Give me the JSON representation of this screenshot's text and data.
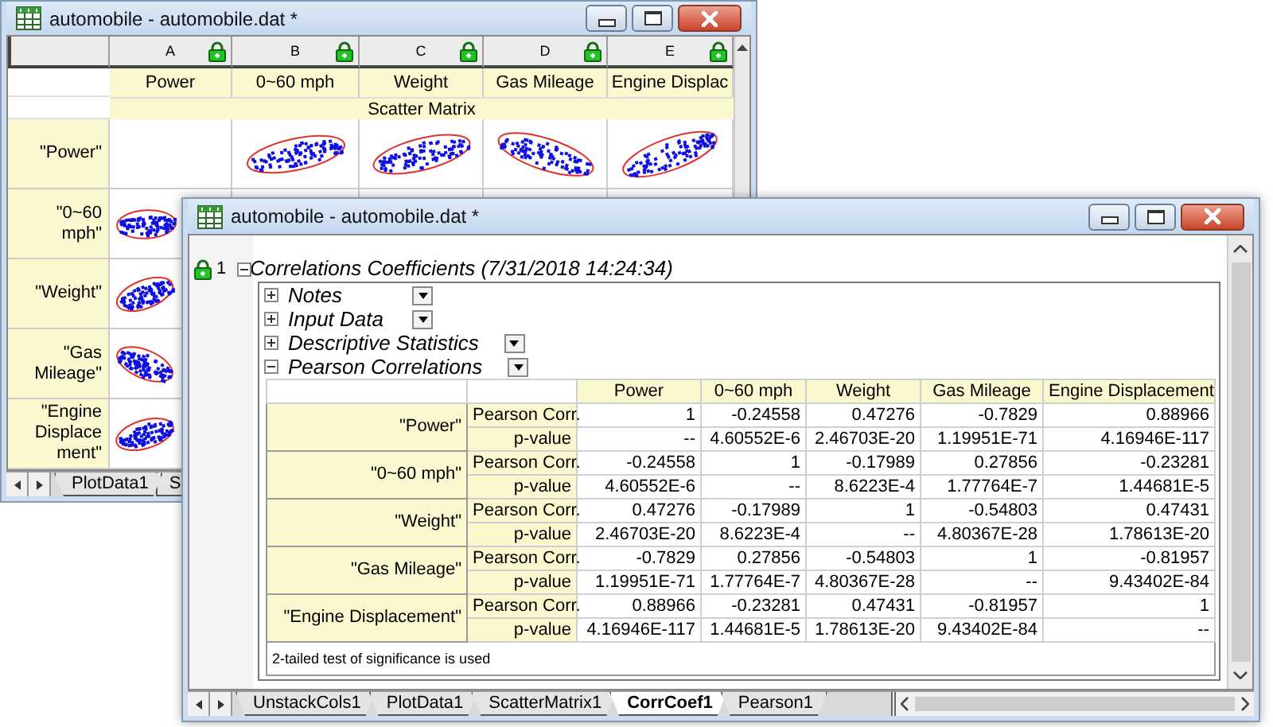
{
  "back_window": {
    "title": "automobile - automobile.dat *",
    "columns": [
      {
        "letter": "A",
        "long_name": "Power"
      },
      {
        "letter": "B",
        "long_name": "0~60 mph"
      },
      {
        "letter": "C",
        "long_name": "Weight"
      },
      {
        "letter": "D",
        "long_name": "Gas Mileage"
      },
      {
        "letter": "E",
        "long_name": "Engine Displac"
      }
    ],
    "comments": "Scatter Matrix",
    "row_labels": [
      "\"Power\"",
      "\"0~60 mph\"",
      "\"Weight\"",
      "\"Gas Mileage\"",
      "\"Engine Displacement\""
    ],
    "sheet_tabs": [
      {
        "label": "PlotData1",
        "selected": false
      },
      {
        "label": "S",
        "selected": false
      }
    ]
  },
  "front_window": {
    "title": "automobile - automobile.dat *",
    "row_number": "1",
    "report_title": "Correlations Coefficients (7/31/2018 14:24:34)",
    "expanded": true,
    "sections": [
      {
        "label": "Notes",
        "expanded": false
      },
      {
        "label": "Input Data",
        "expanded": false
      },
      {
        "label": "Descriptive Statistics",
        "expanded": false
      },
      {
        "label": "Pearson Correlations",
        "expanded": true
      }
    ],
    "table": {
      "columns": [
        "Power",
        "0~60 mph",
        "Weight",
        "Gas Mileage",
        "Engine Displacement"
      ],
      "rows": [
        {
          "label": "\"Power\"",
          "stats": [
            {
              "name": "Pearson Corr.",
              "values": [
                "1",
                "-0.24558",
                "0.47276",
                "-0.7829",
                "0.88966"
              ]
            },
            {
              "name": "p-value",
              "values": [
                "--",
                "4.60552E-6",
                "2.46703E-20",
                "1.19951E-71",
                "4.16946E-117"
              ]
            }
          ]
        },
        {
          "label": "\"0~60 mph\"",
          "stats": [
            {
              "name": "Pearson Corr.",
              "values": [
                "-0.24558",
                "1",
                "-0.17989",
                "0.27856",
                "-0.23281"
              ]
            },
            {
              "name": "p-value",
              "values": [
                "4.60552E-6",
                "--",
                "8.6223E-4",
                "1.77764E-7",
                "1.44681E-5"
              ]
            }
          ]
        },
        {
          "label": "\"Weight\"",
          "stats": [
            {
              "name": "Pearson Corr.",
              "values": [
                "0.47276",
                "-0.17989",
                "1",
                "-0.54803",
                "0.47431"
              ]
            },
            {
              "name": "p-value",
              "values": [
                "2.46703E-20",
                "8.6223E-4",
                "--",
                "4.80367E-28",
                "1.78613E-20"
              ]
            }
          ]
        },
        {
          "label": "\"Gas Mileage\"",
          "stats": [
            {
              "name": "Pearson Corr.",
              "values": [
                "-0.7829",
                "0.27856",
                "-0.54803",
                "1",
                "-0.81957"
              ]
            },
            {
              "name": "p-value",
              "values": [
                "1.19951E-71",
                "1.77764E-7",
                "4.80367E-28",
                "--",
                "9.43402E-84"
              ]
            }
          ]
        },
        {
          "label": "\"Engine Displacement\"",
          "stats": [
            {
              "name": "Pearson Corr.",
              "values": [
                "0.88966",
                "-0.23281",
                "0.47431",
                "-0.81957",
                "1"
              ]
            },
            {
              "name": "p-value",
              "values": [
                "4.16946E-117",
                "1.44681E-5",
                "1.78613E-20",
                "9.43402E-84",
                "--"
              ]
            }
          ]
        }
      ],
      "footnote": "2-tailed test of significance is used"
    },
    "sheet_tabs": [
      {
        "label": "UnstackCols1",
        "selected": false
      },
      {
        "label": "PlotData1",
        "selected": false
      },
      {
        "label": "ScatterMatrix1",
        "selected": false
      },
      {
        "label": "CorrCoef1",
        "selected": true
      },
      {
        "label": "Pearson1",
        "selected": false
      }
    ]
  }
}
